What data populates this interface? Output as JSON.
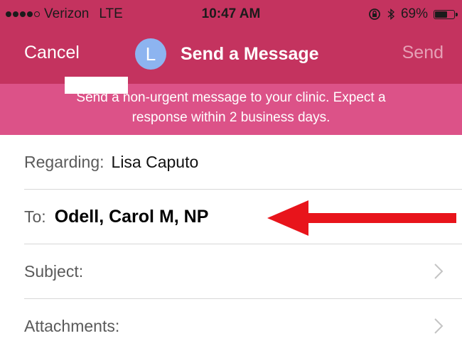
{
  "status_bar": {
    "signal_dots_filled": 4,
    "signal_dots_total": 5,
    "carrier": "Verizon",
    "network": "LTE",
    "time": "10:47 AM",
    "battery": "69%",
    "battery_level": 0.69
  },
  "nav": {
    "cancel_label": "Cancel",
    "avatar_initial": "L",
    "title": "Send a Message",
    "send_label": "Send"
  },
  "banner": {
    "line1": "Send a non-urgent message to your clinic. Expect a",
    "line2": "response within 2 business days."
  },
  "form": {
    "regarding_label": "Regarding:",
    "regarding_value": "Lisa Caputo",
    "to_label": "To:",
    "to_value": "Odell, Carol M, NP",
    "subject_label": "Subject:",
    "attachments_label": "Attachments:"
  },
  "colors": {
    "nav_background": "#c4335f",
    "banner_background": "#dc5288",
    "avatar": "#8db4f0",
    "annotation_arrow": "#e8141b"
  },
  "icons": [
    "lock-rotation-icon",
    "bluetooth-icon",
    "battery-icon",
    "chevron-right-icon",
    "red-arrow-annotation"
  ]
}
